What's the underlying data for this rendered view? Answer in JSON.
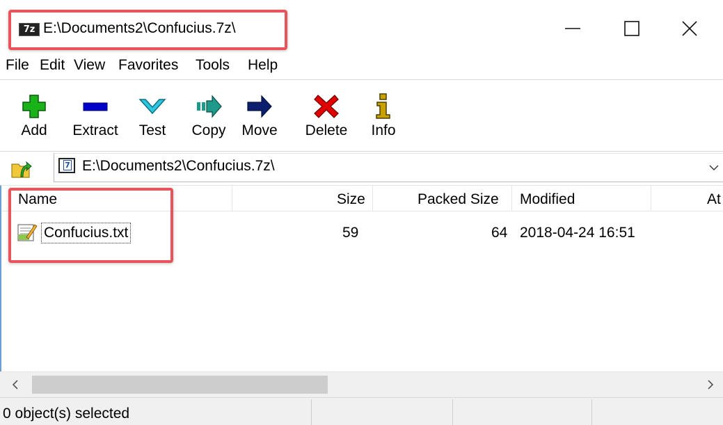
{
  "window": {
    "icon_text": "7z",
    "title": "E:\\Documents2\\Confucius.7z\\"
  },
  "menu": [
    "File",
    "Edit",
    "View",
    "Favorites",
    "Tools",
    "Help"
  ],
  "toolbar": [
    {
      "label": "Add",
      "icon": "add-icon"
    },
    {
      "label": "Extract",
      "icon": "extract-icon"
    },
    {
      "label": "Test",
      "icon": "test-icon"
    },
    {
      "label": "Copy",
      "icon": "copy-icon"
    },
    {
      "label": "Move",
      "icon": "move-icon"
    },
    {
      "label": "Delete",
      "icon": "delete-icon"
    },
    {
      "label": "Info",
      "icon": "info-icon"
    }
  ],
  "address": {
    "icon_text": "7",
    "path": "E:\\Documents2\\Confucius.7z\\"
  },
  "columns": {
    "name": "Name",
    "size": "Size",
    "packed": "Packed Size",
    "modified": "Modified",
    "attributes": "At"
  },
  "files": [
    {
      "name": "Confucius.txt",
      "size": "59",
      "packed": "64",
      "modified": "2018-04-24 16:51"
    }
  ],
  "status": {
    "text": "0 object(s) selected"
  },
  "colors": {
    "highlight": "#e8545a",
    "add": "#19b319",
    "extract": "#0000c8",
    "test": "#2bc6e0",
    "copy": "#1f9a8a",
    "move": "#0b1f6e",
    "delete": "#e00000",
    "info": "#c7a200"
  }
}
